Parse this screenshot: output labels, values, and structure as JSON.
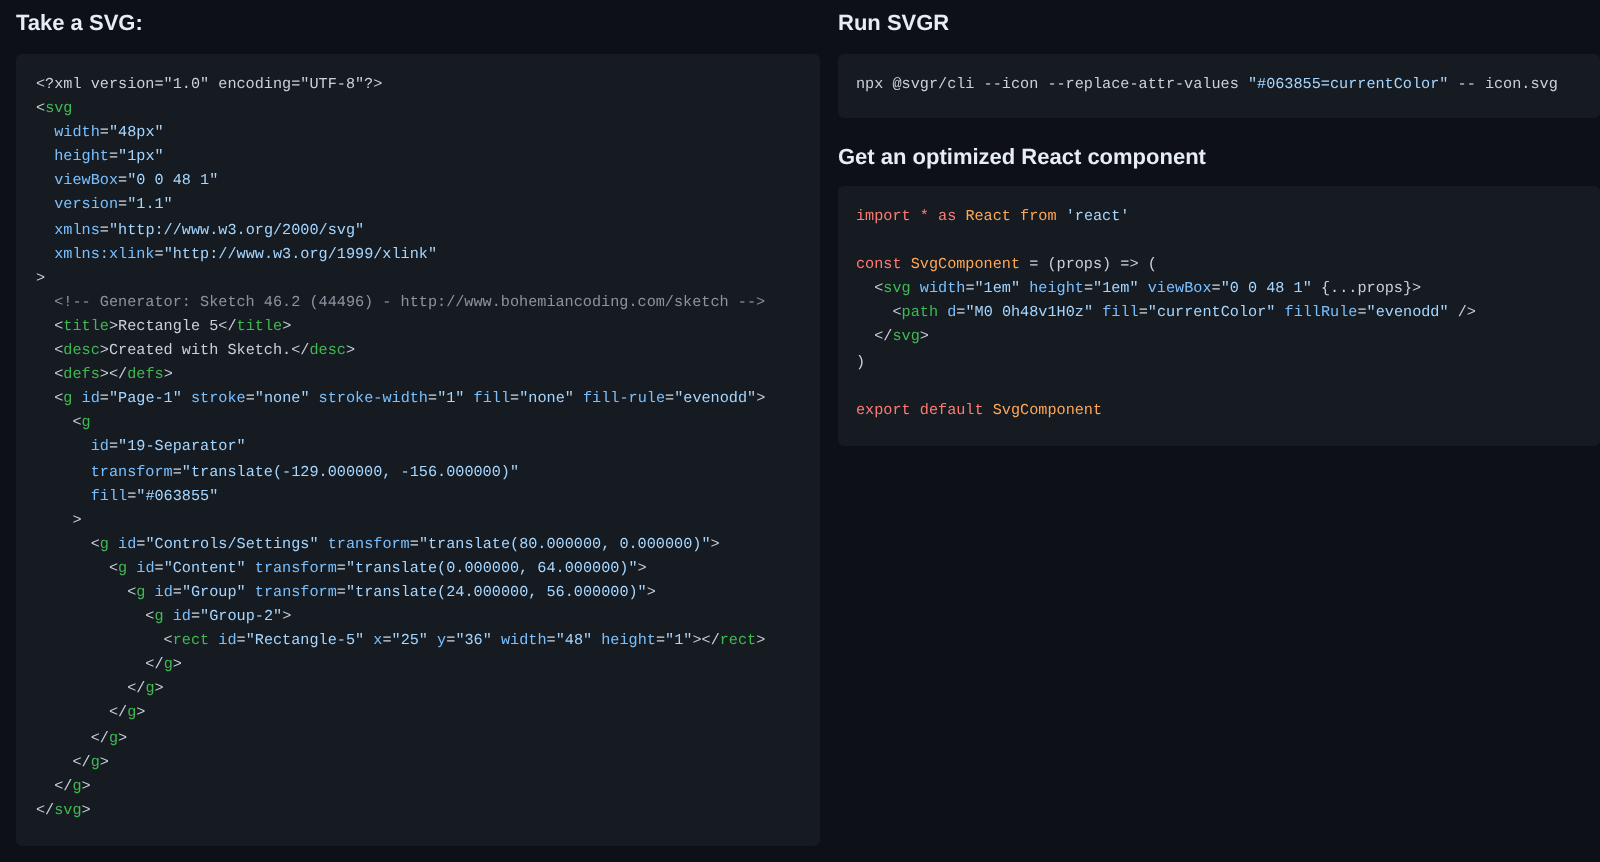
{
  "sections": [
    {
      "heading": "Take a SVG:",
      "code": [
        {
          "kind": "code",
          "tokens": [
            {
              "kind": "plain",
              "text": "<?xml version=\"1.0\" encoding=\"UTF-8\"?>"
            }
          ]
        },
        {
          "kind": "code",
          "tokens": [
            {
              "kind": "plain",
              "text": "<"
            },
            {
              "kind": "tag",
              "text": "svg"
            }
          ]
        },
        {
          "kind": "code",
          "tokens": [
            {
              "kind": "attr",
              "text": "  width"
            },
            {
              "kind": "plain",
              "text": "="
            },
            {
              "kind": "string",
              "text": "\"48px\""
            }
          ]
        },
        {
          "kind": "code",
          "tokens": [
            {
              "kind": "attr",
              "text": "  height"
            },
            {
              "kind": "plain",
              "text": "="
            },
            {
              "kind": "string",
              "text": "\"1px\""
            }
          ]
        },
        {
          "kind": "code",
          "tokens": [
            {
              "kind": "attr",
              "text": "  viewBox"
            },
            {
              "kind": "plain",
              "text": "="
            },
            {
              "kind": "string",
              "text": "\"0 0 48 1\""
            }
          ]
        },
        {
          "kind": "code",
          "tokens": [
            {
              "kind": "attr",
              "text": "  version"
            },
            {
              "kind": "plain",
              "text": "="
            },
            {
              "kind": "string",
              "text": "\"1.1\""
            }
          ]
        },
        {
          "kind": "code",
          "tokens": [
            {
              "kind": "attr",
              "text": "  xmlns"
            },
            {
              "kind": "plain",
              "text": "="
            },
            {
              "kind": "string",
              "text": "\"http://www.w3.org/2000/svg\""
            }
          ]
        },
        {
          "kind": "code",
          "tokens": [
            {
              "kind": "attr",
              "text": "  xmlns:xlink"
            },
            {
              "kind": "plain",
              "text": "="
            },
            {
              "kind": "string",
              "text": "\"http://www.w3.org/1999/xlink\""
            }
          ]
        },
        {
          "kind": "code",
          "tokens": [
            {
              "kind": "plain",
              "text": ">"
            }
          ]
        },
        {
          "kind": "code",
          "tokens": [
            {
              "kind": "comment",
              "text": "  <!-- Generator: Sketch 46.2 (44496) - http://www.bohemiancoding.com/sketch -->"
            }
          ]
        },
        {
          "kind": "code",
          "tokens": [
            {
              "kind": "plain",
              "text": "  <"
            },
            {
              "kind": "tag",
              "text": "title"
            },
            {
              "kind": "plain",
              "text": ">Rectangle 5</"
            },
            {
              "kind": "tag",
              "text": "title"
            },
            {
              "kind": "plain",
              "text": ">"
            }
          ]
        },
        {
          "kind": "code",
          "tokens": [
            {
              "kind": "plain",
              "text": "  <"
            },
            {
              "kind": "tag",
              "text": "desc"
            },
            {
              "kind": "plain",
              "text": ">Created with Sketch.</"
            },
            {
              "kind": "tag",
              "text": "desc"
            },
            {
              "kind": "plain",
              "text": ">"
            }
          ]
        },
        {
          "kind": "code",
          "tokens": [
            {
              "kind": "plain",
              "text": "  <"
            },
            {
              "kind": "tag",
              "text": "defs"
            },
            {
              "kind": "plain",
              "text": "></"
            },
            {
              "kind": "tag",
              "text": "defs"
            },
            {
              "kind": "plain",
              "text": ">"
            }
          ]
        },
        {
          "kind": "code",
          "tokens": [
            {
              "kind": "plain",
              "text": "  <"
            },
            {
              "kind": "tag",
              "text": "g"
            },
            {
              "kind": "attr",
              "text": " id"
            },
            {
              "kind": "plain",
              "text": "="
            },
            {
              "kind": "string",
              "text": "\"Page-1\""
            },
            {
              "kind": "attr",
              "text": " stroke"
            },
            {
              "kind": "plain",
              "text": "="
            },
            {
              "kind": "string",
              "text": "\"none\""
            },
            {
              "kind": "attr",
              "text": " stroke-width"
            },
            {
              "kind": "plain",
              "text": "="
            },
            {
              "kind": "string",
              "text": "\"1\""
            },
            {
              "kind": "attr",
              "text": " fill"
            },
            {
              "kind": "plain",
              "text": "="
            },
            {
              "kind": "string",
              "text": "\"none\""
            },
            {
              "kind": "attr",
              "text": " fill-rule"
            },
            {
              "kind": "plain",
              "text": "="
            },
            {
              "kind": "string",
              "text": "\"evenodd\""
            },
            {
              "kind": "plain",
              "text": ">"
            }
          ]
        },
        {
          "kind": "code",
          "tokens": [
            {
              "kind": "plain",
              "text": "    <"
            },
            {
              "kind": "tag",
              "text": "g"
            }
          ]
        },
        {
          "kind": "code",
          "tokens": [
            {
              "kind": "attr",
              "text": "      id"
            },
            {
              "kind": "plain",
              "text": "="
            },
            {
              "kind": "string",
              "text": "\"19-Separator\""
            }
          ]
        },
        {
          "kind": "code",
          "tokens": [
            {
              "kind": "attr",
              "text": "      transform"
            },
            {
              "kind": "plain",
              "text": "="
            },
            {
              "kind": "string",
              "text": "\"translate(-129.000000, -156.000000)\""
            }
          ]
        },
        {
          "kind": "code",
          "tokens": [
            {
              "kind": "attr",
              "text": "      fill"
            },
            {
              "kind": "plain",
              "text": "="
            },
            {
              "kind": "string",
              "text": "\"#063855\""
            }
          ]
        },
        {
          "kind": "code",
          "tokens": [
            {
              "kind": "plain",
              "text": "    >"
            }
          ]
        },
        {
          "kind": "code",
          "tokens": [
            {
              "kind": "plain",
              "text": "      <"
            },
            {
              "kind": "tag",
              "text": "g"
            },
            {
              "kind": "attr",
              "text": " id"
            },
            {
              "kind": "plain",
              "text": "="
            },
            {
              "kind": "string",
              "text": "\"Controls/Settings\""
            },
            {
              "kind": "attr",
              "text": " transform"
            },
            {
              "kind": "plain",
              "text": "="
            },
            {
              "kind": "string",
              "text": "\"translate(80.000000, 0.000000)\""
            },
            {
              "kind": "plain",
              "text": ">"
            }
          ]
        },
        {
          "kind": "code",
          "tokens": [
            {
              "kind": "plain",
              "text": "        <"
            },
            {
              "kind": "tag",
              "text": "g"
            },
            {
              "kind": "attr",
              "text": " id"
            },
            {
              "kind": "plain",
              "text": "="
            },
            {
              "kind": "string",
              "text": "\"Content\""
            },
            {
              "kind": "attr",
              "text": " transform"
            },
            {
              "kind": "plain",
              "text": "="
            },
            {
              "kind": "string",
              "text": "\"translate(0.000000, 64.000000)\""
            },
            {
              "kind": "plain",
              "text": ">"
            }
          ]
        },
        {
          "kind": "code",
          "tokens": [
            {
              "kind": "plain",
              "text": "          <"
            },
            {
              "kind": "tag",
              "text": "g"
            },
            {
              "kind": "attr",
              "text": " id"
            },
            {
              "kind": "plain",
              "text": "="
            },
            {
              "kind": "string",
              "text": "\"Group\""
            },
            {
              "kind": "attr",
              "text": " transform"
            },
            {
              "kind": "plain",
              "text": "="
            },
            {
              "kind": "string",
              "text": "\"translate(24.000000, 56.000000)\""
            },
            {
              "kind": "plain",
              "text": ">"
            }
          ]
        },
        {
          "kind": "code",
          "tokens": [
            {
              "kind": "plain",
              "text": "            <"
            },
            {
              "kind": "tag",
              "text": "g"
            },
            {
              "kind": "attr",
              "text": " id"
            },
            {
              "kind": "plain",
              "text": "="
            },
            {
              "kind": "string",
              "text": "\"Group-2\""
            },
            {
              "kind": "plain",
              "text": ">"
            }
          ]
        },
        {
          "kind": "code",
          "tokens": [
            {
              "kind": "plain",
              "text": "              <"
            },
            {
              "kind": "tag",
              "text": "rect"
            },
            {
              "kind": "attr",
              "text": " id"
            },
            {
              "kind": "plain",
              "text": "="
            },
            {
              "kind": "string",
              "text": "\"Rectangle-5\""
            },
            {
              "kind": "attr",
              "text": " x"
            },
            {
              "kind": "plain",
              "text": "="
            },
            {
              "kind": "string",
              "text": "\"25\""
            },
            {
              "kind": "attr",
              "text": " y"
            },
            {
              "kind": "plain",
              "text": "="
            },
            {
              "kind": "string",
              "text": "\"36\""
            },
            {
              "kind": "attr",
              "text": " width"
            },
            {
              "kind": "plain",
              "text": "="
            },
            {
              "kind": "string",
              "text": "\"48\""
            },
            {
              "kind": "attr",
              "text": " height"
            },
            {
              "kind": "plain",
              "text": "="
            },
            {
              "kind": "string",
              "text": "\"1\""
            },
            {
              "kind": "plain",
              "text": "></"
            },
            {
              "kind": "tag",
              "text": "rect"
            },
            {
              "kind": "plain",
              "text": ">"
            }
          ]
        },
        {
          "kind": "code",
          "tokens": [
            {
              "kind": "plain",
              "text": "            </"
            },
            {
              "kind": "tag",
              "text": "g"
            },
            {
              "kind": "plain",
              "text": ">"
            }
          ]
        },
        {
          "kind": "code",
          "tokens": [
            {
              "kind": "plain",
              "text": "          </"
            },
            {
              "kind": "tag",
              "text": "g"
            },
            {
              "kind": "plain",
              "text": ">"
            }
          ]
        },
        {
          "kind": "code",
          "tokens": [
            {
              "kind": "plain",
              "text": "        </"
            },
            {
              "kind": "tag",
              "text": "g"
            },
            {
              "kind": "plain",
              "text": ">"
            }
          ]
        },
        {
          "kind": "code",
          "tokens": [
            {
              "kind": "plain",
              "text": "      </"
            },
            {
              "kind": "tag",
              "text": "g"
            },
            {
              "kind": "plain",
              "text": ">"
            }
          ]
        },
        {
          "kind": "code",
          "tokens": [
            {
              "kind": "plain",
              "text": "    </"
            },
            {
              "kind": "tag",
              "text": "g"
            },
            {
              "kind": "plain",
              "text": ">"
            }
          ]
        },
        {
          "kind": "code",
          "tokens": [
            {
              "kind": "plain",
              "text": "  </"
            },
            {
              "kind": "tag",
              "text": "g"
            },
            {
              "kind": "plain",
              "text": ">"
            }
          ]
        },
        {
          "kind": "code",
          "tokens": [
            {
              "kind": "plain",
              "text": "</"
            },
            {
              "kind": "tag",
              "text": "svg"
            },
            {
              "kind": "plain",
              "text": ">"
            }
          ]
        }
      ]
    },
    {
      "heading": "Run SVGR",
      "code": [
        {
          "kind": "code",
          "tokens": [
            {
              "kind": "plain",
              "text": "npx @svgr/cli --icon --replace-attr-values "
            },
            {
              "kind": "string",
              "text": "\"#063855=currentColor\""
            },
            {
              "kind": "plain",
              "text": " -- icon.svg"
            }
          ]
        }
      ]
    },
    {
      "heading": "Get an optimized React component",
      "code": [
        {
          "kind": "code",
          "tokens": [
            {
              "kind": "keyword",
              "text": "import * as "
            },
            {
              "kind": "name",
              "text": "React from "
            },
            {
              "kind": "string",
              "text": "'react'"
            }
          ]
        },
        {
          "kind": "blank"
        },
        {
          "kind": "code",
          "tokens": [
            {
              "kind": "keyword",
              "text": "const "
            },
            {
              "kind": "name",
              "text": "SvgComponent"
            },
            {
              "kind": "plain",
              "text": " = (props) => ("
            }
          ]
        },
        {
          "kind": "code",
          "tokens": [
            {
              "kind": "plain",
              "text": "  <"
            },
            {
              "kind": "tag",
              "text": "svg"
            },
            {
              "kind": "attr",
              "text": " width"
            },
            {
              "kind": "plain",
              "text": "="
            },
            {
              "kind": "string",
              "text": "\"1em\""
            },
            {
              "kind": "attr",
              "text": " height"
            },
            {
              "kind": "plain",
              "text": "="
            },
            {
              "kind": "string",
              "text": "\"1em\""
            },
            {
              "kind": "attr",
              "text": " viewBox"
            },
            {
              "kind": "plain",
              "text": "="
            },
            {
              "kind": "string",
              "text": "\"0 0 48 1\""
            },
            {
              "kind": "plain",
              "text": " {...props}>"
            }
          ]
        },
        {
          "kind": "code",
          "tokens": [
            {
              "kind": "plain",
              "text": "    <"
            },
            {
              "kind": "tag",
              "text": "path"
            },
            {
              "kind": "attr",
              "text": " d"
            },
            {
              "kind": "plain",
              "text": "="
            },
            {
              "kind": "string",
              "text": "\"M0 0h48v1H0z\""
            },
            {
              "kind": "attr",
              "text": " fill"
            },
            {
              "kind": "plain",
              "text": "="
            },
            {
              "kind": "string",
              "text": "\"currentColor\""
            },
            {
              "kind": "attr",
              "text": " fillRule"
            },
            {
              "kind": "plain",
              "text": "="
            },
            {
              "kind": "string",
              "text": "\"evenodd\""
            },
            {
              "kind": "plain",
              "text": " />"
            }
          ]
        },
        {
          "kind": "code",
          "tokens": [
            {
              "kind": "plain",
              "text": "  </"
            },
            {
              "kind": "tag",
              "text": "svg"
            },
            {
              "kind": "plain",
              "text": ">"
            }
          ]
        },
        {
          "kind": "code",
          "tokens": [
            {
              "kind": "plain",
              "text": ")"
            }
          ]
        },
        {
          "kind": "blank"
        },
        {
          "kind": "code",
          "tokens": [
            {
              "kind": "keyword",
              "text": "export default "
            },
            {
              "kind": "name",
              "text": "SvgComponent"
            }
          ]
        }
      ]
    }
  ]
}
